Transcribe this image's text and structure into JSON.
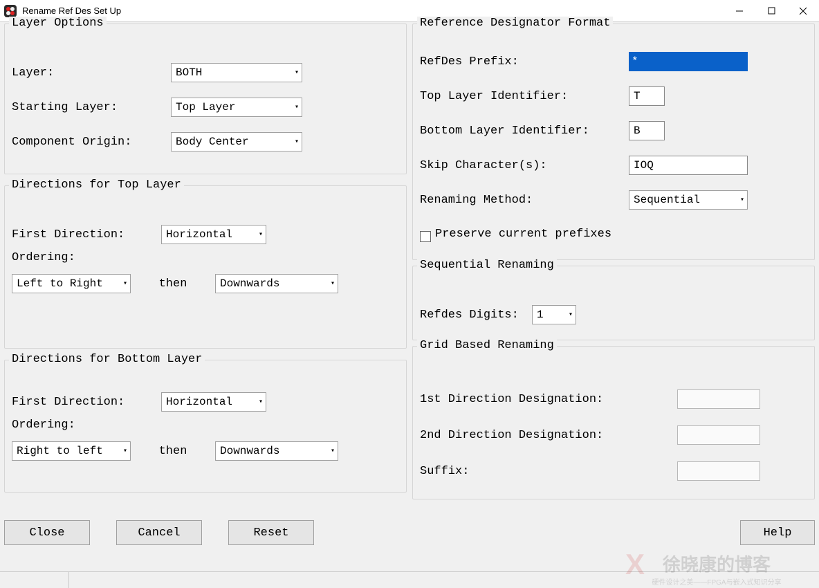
{
  "window": {
    "title": "Rename Ref Des Set Up"
  },
  "layer_options": {
    "title": "Layer Options",
    "layer_label": "Layer:",
    "layer_value": "BOTH",
    "starting_layer_label": "Starting Layer:",
    "starting_layer_value": "Top Layer",
    "component_origin_label": "Component Origin:",
    "component_origin_value": "Body Center"
  },
  "dir_top": {
    "title": "Directions for Top Layer",
    "first_dir_label": "First Direction:",
    "first_dir_value": "Horizontal",
    "ordering_label": "Ordering:",
    "order1_value": "Left to Right",
    "then_label": "then",
    "order2_value": "Downwards"
  },
  "dir_bottom": {
    "title": "Directions for Bottom Layer",
    "first_dir_label": "First Direction:",
    "first_dir_value": "Horizontal",
    "ordering_label": "Ordering:",
    "order1_value": "Right to left",
    "then_label": "then",
    "order2_value": "Downwards"
  },
  "refdes_format": {
    "title": "Reference Designator Format",
    "prefix_label": "RefDes Prefix:",
    "prefix_value": "*",
    "top_id_label": "Top Layer Identifier:",
    "top_id_value": "T",
    "bottom_id_label": "Bottom Layer Identifier:",
    "bottom_id_value": "B",
    "skip_label": "Skip Character(s):",
    "skip_value": "IOQ",
    "method_label": "Renaming Method:",
    "method_value": "Sequential",
    "preserve_label": "Preserve current prefixes"
  },
  "sequential": {
    "title": "Sequential Renaming",
    "digits_label": "Refdes Digits:",
    "digits_value": "1"
  },
  "grid": {
    "title": "Grid Based Renaming",
    "d1_label": "1st Direction Designation:",
    "d1_value": "",
    "d2_label": "2nd Direction Designation:",
    "d2_value": "",
    "suffix_label": "Suffix:",
    "suffix_value": ""
  },
  "buttons": {
    "close": "Close",
    "cancel": "Cancel",
    "reset": "Reset",
    "help": "Help"
  },
  "watermark": {
    "main": "徐晓康的博客",
    "sub": "硬件设计之美——FPGA与嵌入式知识分享"
  }
}
